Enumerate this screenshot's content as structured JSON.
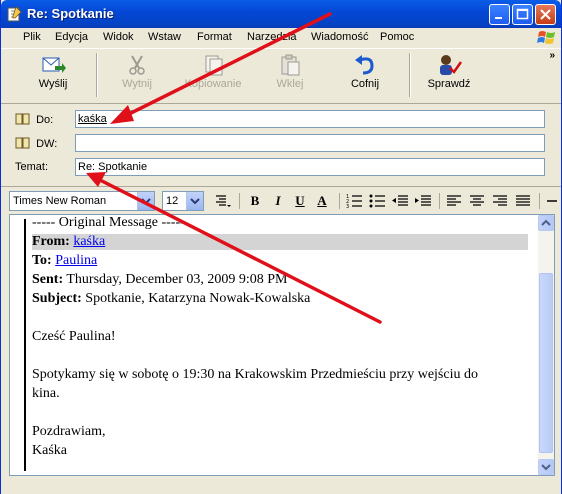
{
  "window": {
    "title": "Re: Spotkanie"
  },
  "menu": [
    "Plik",
    "Edycja",
    "Widok",
    "Wstaw",
    "Format",
    "Narzędzia",
    "Wiadomość",
    "Pomoc"
  ],
  "toolbar": {
    "send": "Wyślij",
    "cut": "Wytnij",
    "copy": "Kopiowanie",
    "paste": "Wklej",
    "undo": "Cofnij",
    "check": "Sprawdź"
  },
  "headers": {
    "to_label": "Do:",
    "to_value": "kaśka",
    "cc_label": "DW:",
    "cc_value": "",
    "subject_label": "Temat:",
    "subject_value": "Re: Spotkanie"
  },
  "format": {
    "font": "Times New Roman",
    "size": "12",
    "bold": "B",
    "italic": "I",
    "underline": "U",
    "color": "A"
  },
  "message": {
    "original": "----- Original Message -----",
    "from_label": "From:",
    "from_value": "kaśka",
    "to_label": "To:",
    "to_value": "Paulina",
    "sent_label": "Sent:",
    "sent_value": "Thursday, December 03, 2009 9:08 PM",
    "subject_label": "Subject:",
    "subject_value": "Spotkanie, Katarzyna Nowak-Kowalska",
    "greeting": "Cześć Paulina!",
    "line1": "Spotykamy się w sobotę o 19:30 na Krakowskim Przedmieściu przy wejściu do",
    "line2": "kina.",
    "closing": "Pozdrawiam,",
    "signature": "Kaśka"
  },
  "colors": {
    "title": "#0548d6",
    "arrow": "#e0101a",
    "link": "#0000ee"
  }
}
